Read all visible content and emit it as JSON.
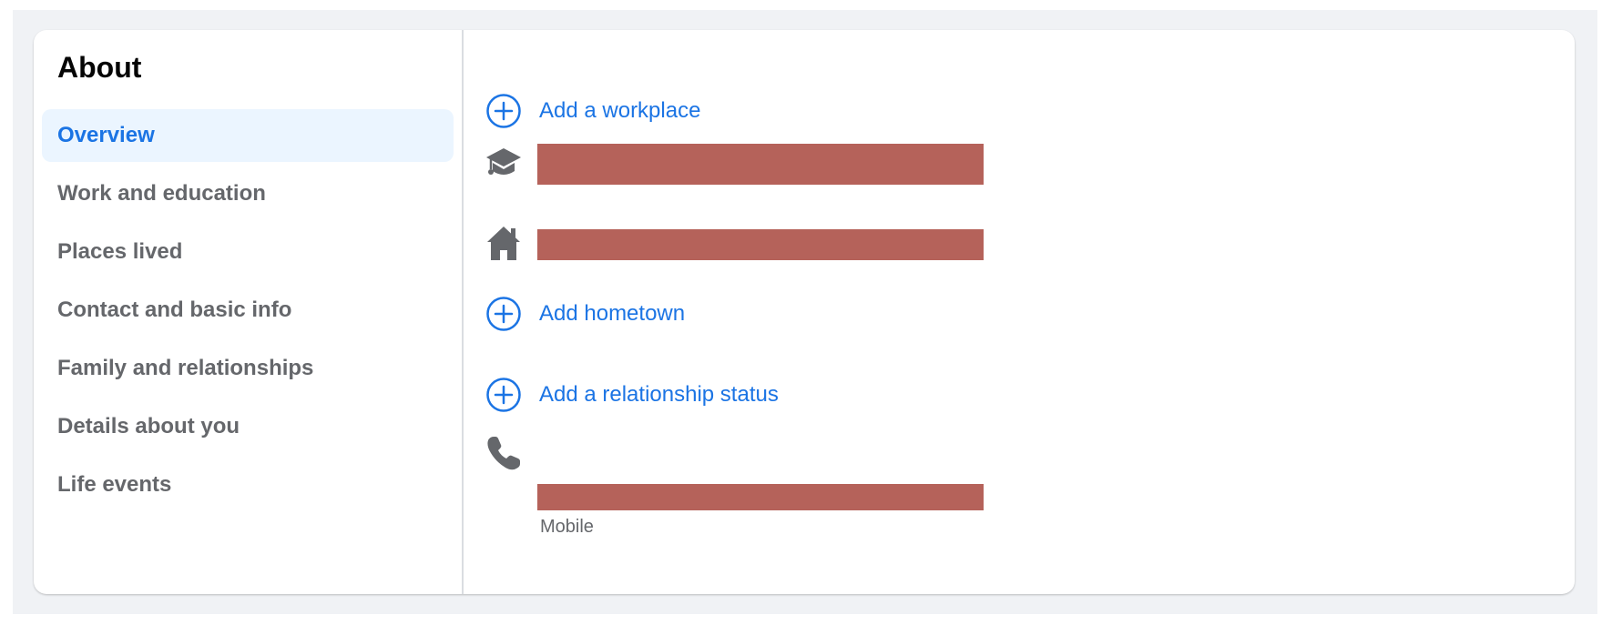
{
  "about": {
    "title": "About",
    "nav": [
      {
        "label": "Overview",
        "active": true
      },
      {
        "label": "Work and education",
        "active": false
      },
      {
        "label": "Places lived",
        "active": false
      },
      {
        "label": "Contact and basic info",
        "active": false
      },
      {
        "label": "Family and relationships",
        "active": false
      },
      {
        "label": "Details about you",
        "active": false
      },
      {
        "label": "Life events",
        "active": false
      }
    ]
  },
  "overview": {
    "add_workplace": "Add a workplace",
    "add_hometown": "Add hometown",
    "add_relationship": "Add a relationship status",
    "education": {
      "icon": "graduation-cap-icon",
      "privacy": "lock-icon",
      "action": "more-options-icon"
    },
    "lives_in": {
      "icon": "home-icon",
      "privacy": "friends-icon",
      "action": "more-options-icon"
    },
    "phone": {
      "icon": "phone-icon",
      "sub_label": "Mobile",
      "privacy": "lock-icon",
      "action": "pencil-icon"
    }
  },
  "colors": {
    "accent": "#1b74e4",
    "nav_active_bg": "#ebf5ff",
    "muted_text": "#65676b",
    "icon_gray": "#65676b",
    "redaction": "#b5625a",
    "button_bg": "#e4e6eb",
    "page_bg": "#f0f2f5"
  }
}
